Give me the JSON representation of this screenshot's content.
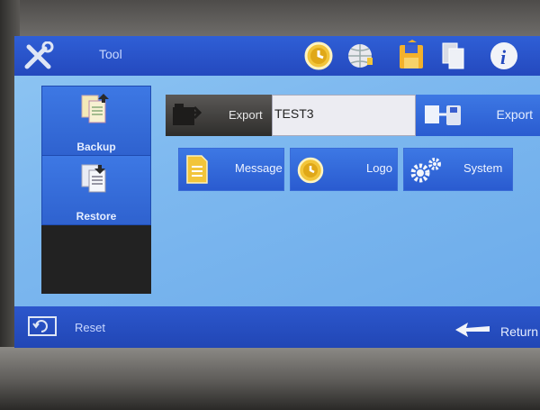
{
  "topbar": {
    "tool_label": "Tool"
  },
  "sidebar": {
    "items": [
      {
        "label": "Backup"
      },
      {
        "label": "Restore"
      }
    ]
  },
  "export": {
    "button_label": "Export",
    "filename_value": "TEST3",
    "action_label": "Export"
  },
  "functions": [
    {
      "label": "Message"
    },
    {
      "label": "Logo"
    },
    {
      "label": "System"
    }
  ],
  "bottombar": {
    "reset_label": "Reset",
    "return_label": "Return"
  },
  "colors": {
    "accent": "#2a5bd0",
    "active_tab": "#f2b12c",
    "icon_yellow": "#f2c53a"
  }
}
